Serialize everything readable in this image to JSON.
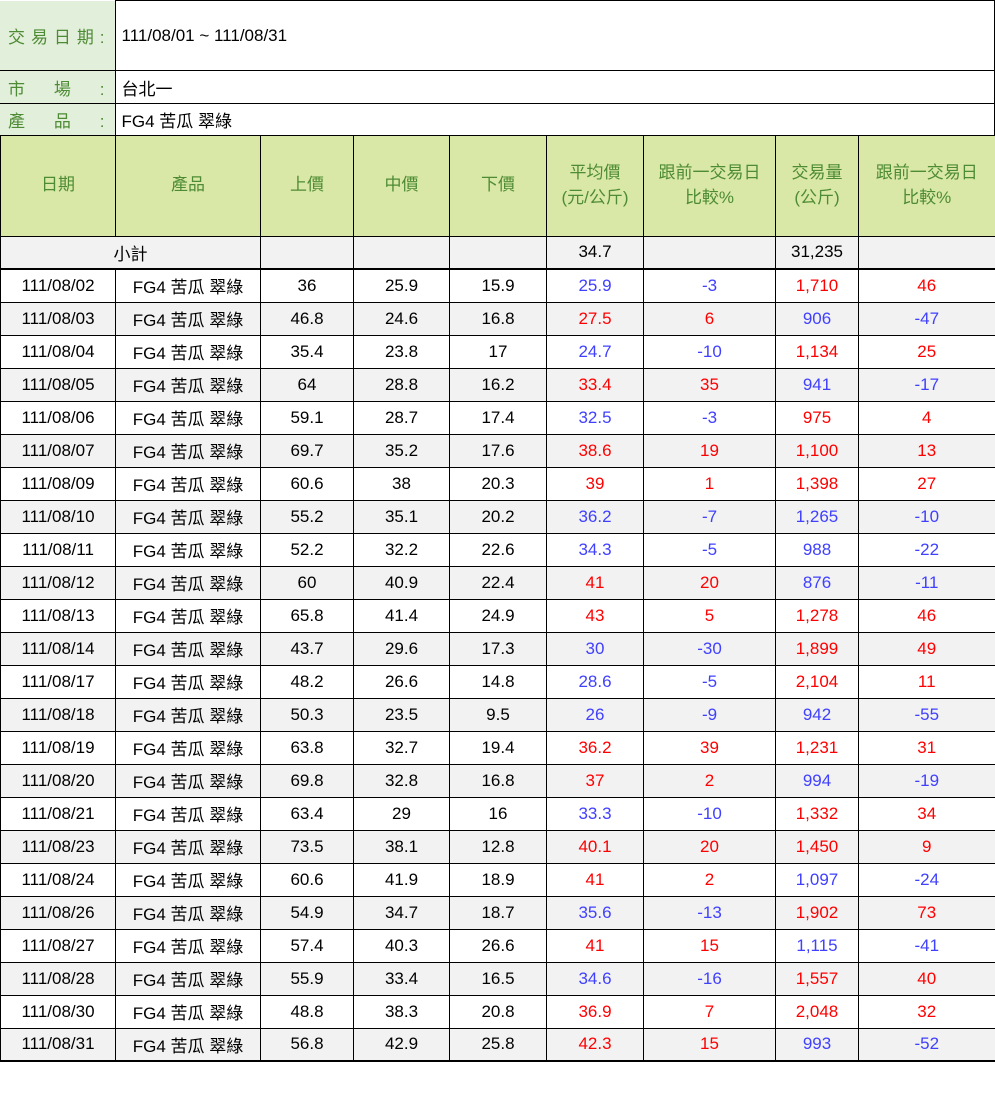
{
  "info": {
    "rows": [
      {
        "label": "交易日期:",
        "value": "111/08/01 ~ 111/08/31"
      },
      {
        "label": "市場:",
        "value": "台北一"
      },
      {
        "label": "產品:",
        "value": "FG4 苦瓜 翠綠"
      }
    ]
  },
  "table": {
    "headers": [
      "日期",
      "產品",
      "上價",
      "中價",
      "下價",
      "平均價\n(元/公斤)",
      "跟前一交易日\n比較%",
      "交易量\n(公斤)",
      "跟前一交易日\n比較%"
    ],
    "subtotal": {
      "label": "小計",
      "avg": "34.7",
      "volume": "31,235"
    },
    "rows": [
      [
        "111/08/02",
        "FG4 苦瓜 翠綠",
        "36",
        "25.9",
        "15.9",
        "25.9",
        "-3",
        "1,710",
        "46"
      ],
      [
        "111/08/03",
        "FG4 苦瓜 翠綠",
        "46.8",
        "24.6",
        "16.8",
        "27.5",
        "6",
        "906",
        "-47"
      ],
      [
        "111/08/04",
        "FG4 苦瓜 翠綠",
        "35.4",
        "23.8",
        "17",
        "24.7",
        "-10",
        "1,134",
        "25"
      ],
      [
        "111/08/05",
        "FG4 苦瓜 翠綠",
        "64",
        "28.8",
        "16.2",
        "33.4",
        "35",
        "941",
        "-17"
      ],
      [
        "111/08/06",
        "FG4 苦瓜 翠綠",
        "59.1",
        "28.7",
        "17.4",
        "32.5",
        "-3",
        "975",
        "4"
      ],
      [
        "111/08/07",
        "FG4 苦瓜 翠綠",
        "69.7",
        "35.2",
        "17.6",
        "38.6",
        "19",
        "1,100",
        "13"
      ],
      [
        "111/08/09",
        "FG4 苦瓜 翠綠",
        "60.6",
        "38",
        "20.3",
        "39",
        "1",
        "1,398",
        "27"
      ],
      [
        "111/08/10",
        "FG4 苦瓜 翠綠",
        "55.2",
        "35.1",
        "20.2",
        "36.2",
        "-7",
        "1,265",
        "-10"
      ],
      [
        "111/08/11",
        "FG4 苦瓜 翠綠",
        "52.2",
        "32.2",
        "22.6",
        "34.3",
        "-5",
        "988",
        "-22"
      ],
      [
        "111/08/12",
        "FG4 苦瓜 翠綠",
        "60",
        "40.9",
        "22.4",
        "41",
        "20",
        "876",
        "-11"
      ],
      [
        "111/08/13",
        "FG4 苦瓜 翠綠",
        "65.8",
        "41.4",
        "24.9",
        "43",
        "5",
        "1,278",
        "46"
      ],
      [
        "111/08/14",
        "FG4 苦瓜 翠綠",
        "43.7",
        "29.6",
        "17.3",
        "30",
        "-30",
        "1,899",
        "49"
      ],
      [
        "111/08/17",
        "FG4 苦瓜 翠綠",
        "48.2",
        "26.6",
        "14.8",
        "28.6",
        "-5",
        "2,104",
        "11"
      ],
      [
        "111/08/18",
        "FG4 苦瓜 翠綠",
        "50.3",
        "23.5",
        "9.5",
        "26",
        "-9",
        "942",
        "-55"
      ],
      [
        "111/08/19",
        "FG4 苦瓜 翠綠",
        "63.8",
        "32.7",
        "19.4",
        "36.2",
        "39",
        "1,231",
        "31"
      ],
      [
        "111/08/20",
        "FG4 苦瓜 翠綠",
        "69.8",
        "32.8",
        "16.8",
        "37",
        "2",
        "994",
        "-19"
      ],
      [
        "111/08/21",
        "FG4 苦瓜 翠綠",
        "63.4",
        "29",
        "16",
        "33.3",
        "-10",
        "1,332",
        "34"
      ],
      [
        "111/08/23",
        "FG4 苦瓜 翠綠",
        "73.5",
        "38.1",
        "12.8",
        "40.1",
        "20",
        "1,450",
        "9"
      ],
      [
        "111/08/24",
        "FG4 苦瓜 翠綠",
        "60.6",
        "41.9",
        "18.9",
        "41",
        "2",
        "1,097",
        "-24"
      ],
      [
        "111/08/26",
        "FG4 苦瓜 翠綠",
        "54.9",
        "34.7",
        "18.7",
        "35.6",
        "-13",
        "1,902",
        "73"
      ],
      [
        "111/08/27",
        "FG4 苦瓜 翠綠",
        "57.4",
        "40.3",
        "26.6",
        "41",
        "15",
        "1,115",
        "-41"
      ],
      [
        "111/08/28",
        "FG4 苦瓜 翠綠",
        "55.9",
        "33.4",
        "16.5",
        "34.6",
        "-16",
        "1,557",
        "40"
      ],
      [
        "111/08/30",
        "FG4 苦瓜 翠綠",
        "48.8",
        "38.3",
        "20.8",
        "36.9",
        "7",
        "2,048",
        "32"
      ],
      [
        "111/08/31",
        "FG4 苦瓜 翠綠",
        "56.8",
        "42.9",
        "25.8",
        "42.3",
        "15",
        "993",
        "-52"
      ]
    ]
  },
  "colors": {
    "positive_change": "#FF0000",
    "negative_change": "#4040FF",
    "header_bg": "#D9E8A6",
    "green_text": "#4E8B35",
    "info_label_bg": "#E2EFDA",
    "stripe_bg": "#F2F2F2",
    "border": "#000000"
  }
}
